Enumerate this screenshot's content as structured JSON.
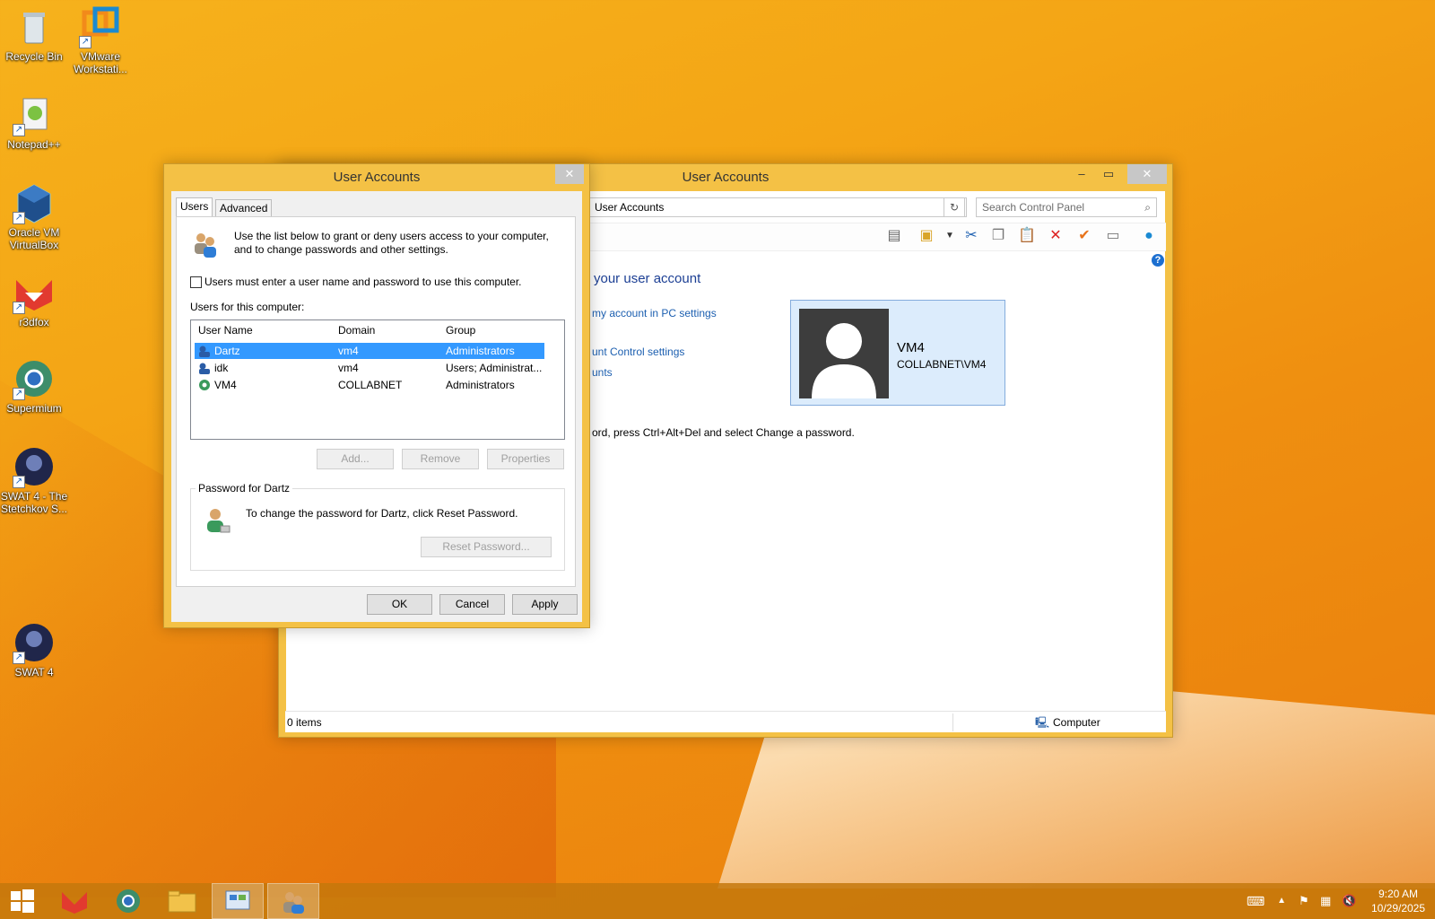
{
  "desktop": {
    "icons": [
      {
        "label": "Recycle Bin",
        "icon": "recycle-bin-icon"
      },
      {
        "label": "VMware Workstati...",
        "icon": "vmware-icon"
      },
      {
        "label": "Notepad++",
        "icon": "notepad-plus-plus-icon"
      },
      {
        "label": "Oracle VM VirtualBox",
        "icon": "virtualbox-icon"
      },
      {
        "label": "r3dfox",
        "icon": "r3dfox-icon"
      },
      {
        "label": "Supermium",
        "icon": "supermium-icon"
      },
      {
        "label": "SWAT 4 - The Stetchkov S...",
        "icon": "swat4-icon"
      },
      {
        "label": "SWAT 4",
        "icon": "swat4-icon"
      }
    ]
  },
  "control_panel": {
    "title": "User Accounts",
    "address": "User Accounts",
    "search_placeholder": "Search Control Panel",
    "heading": "your user account",
    "links": [
      "my account in PC settings",
      "unt Control settings",
      "unts"
    ],
    "hint": "ord, press Ctrl+Alt+Del and select Change a password.",
    "user_card": {
      "name": "VM4",
      "account": "COLLABNET\\VM4"
    },
    "status": {
      "items": "0 items",
      "location": "Computer"
    },
    "help": "?"
  },
  "dialog": {
    "title": "User Accounts",
    "tabs": [
      "Users",
      "Advanced"
    ],
    "intro": "Use the list below to grant or deny users access to your computer, and to change passwords and other settings.",
    "checkbox_label": "Users must enter a user name and password to use this computer.",
    "checkbox_checked": false,
    "list_label": "Users for this computer:",
    "columns": [
      "User Name",
      "Domain",
      "Group"
    ],
    "rows": [
      {
        "name": "Dartz",
        "domain": "vm4",
        "group": "Administrators",
        "selected": true
      },
      {
        "name": "idk",
        "domain": "vm4",
        "group": "Users; Administrat...",
        "selected": false
      },
      {
        "name": "VM4",
        "domain": "COLLABNET",
        "group": "Administrators",
        "selected": false
      }
    ],
    "list_buttons": {
      "add": "Add...",
      "remove": "Remove",
      "properties": "Properties"
    },
    "password_group": "Password for Dartz",
    "password_text": "To change the password for Dartz, click Reset Password.",
    "reset_button": "Reset Password...",
    "footer": {
      "ok": "OK",
      "cancel": "Cancel",
      "apply": "Apply"
    },
    "close": "✕"
  },
  "taskbar": {
    "time": "9:20 AM",
    "date": "10/29/2025"
  }
}
